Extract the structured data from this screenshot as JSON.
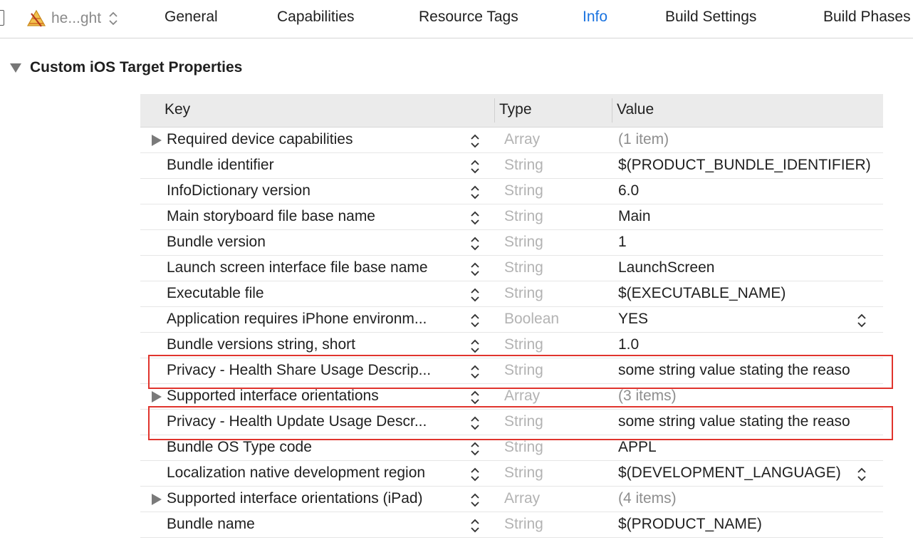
{
  "topbar": {
    "target_name": "he...ght",
    "tabs": [
      {
        "label": "General",
        "active": false
      },
      {
        "label": "Capabilities",
        "active": false
      },
      {
        "label": "Resource Tags",
        "active": false
      },
      {
        "label": "Info",
        "active": true
      },
      {
        "label": "Build Settings",
        "active": false
      },
      {
        "label": "Build Phases",
        "active": false
      }
    ],
    "active_color": "#1a73e0"
  },
  "section": {
    "title": "Custom iOS Target Properties",
    "expanded": true
  },
  "table": {
    "headers": {
      "key": "Key",
      "type": "Type",
      "value": "Value"
    },
    "rows": [
      {
        "key": "Required device capabilities",
        "type": "Array",
        "value": "(1 item)",
        "expandable": true,
        "value_muted": true,
        "value_popup": false,
        "highlighted": false
      },
      {
        "key": "Bundle identifier",
        "type": "String",
        "value": "$(PRODUCT_BUNDLE_IDENTIFIER)",
        "expandable": false,
        "value_muted": false,
        "value_popup": false,
        "highlighted": false
      },
      {
        "key": "InfoDictionary version",
        "type": "String",
        "value": "6.0",
        "expandable": false,
        "value_muted": false,
        "value_popup": false,
        "highlighted": false
      },
      {
        "key": "Main storyboard file base name",
        "type": "String",
        "value": "Main",
        "expandable": false,
        "value_muted": false,
        "value_popup": false,
        "highlighted": false
      },
      {
        "key": "Bundle version",
        "type": "String",
        "value": "1",
        "expandable": false,
        "value_muted": false,
        "value_popup": false,
        "highlighted": false
      },
      {
        "key": "Launch screen interface file base name",
        "type": "String",
        "value": "LaunchScreen",
        "expandable": false,
        "value_muted": false,
        "value_popup": false,
        "highlighted": false
      },
      {
        "key": "Executable file",
        "type": "String",
        "value": "$(EXECUTABLE_NAME)",
        "expandable": false,
        "value_muted": false,
        "value_popup": false,
        "highlighted": false
      },
      {
        "key": "Application requires iPhone environm...",
        "type": "Boolean",
        "value": "YES",
        "expandable": false,
        "value_muted": false,
        "value_popup": true,
        "highlighted": false
      },
      {
        "key": "Bundle versions string, short",
        "type": "String",
        "value": "1.0",
        "expandable": false,
        "value_muted": false,
        "value_popup": false,
        "highlighted": false
      },
      {
        "key": "Privacy - Health Share Usage Descrip...",
        "type": "String",
        "value": "some string value stating the reaso",
        "expandable": false,
        "value_muted": false,
        "value_popup": false,
        "highlighted": true
      },
      {
        "key": "Supported interface orientations",
        "type": "Array",
        "value": "(3 items)",
        "expandable": true,
        "value_muted": true,
        "value_popup": false,
        "highlighted": false
      },
      {
        "key": "Privacy - Health Update Usage Descr...",
        "type": "String",
        "value": "some string value stating the reaso",
        "expandable": false,
        "value_muted": false,
        "value_popup": false,
        "highlighted": true
      },
      {
        "key": "Bundle OS Type code",
        "type": "String",
        "value": "APPL",
        "expandable": false,
        "value_muted": false,
        "value_popup": false,
        "highlighted": false
      },
      {
        "key": "Localization native development region",
        "type": "String",
        "value": "$(DEVELOPMENT_LANGUAGE)",
        "expandable": false,
        "value_muted": false,
        "value_popup": true,
        "highlighted": false
      },
      {
        "key": "Supported interface orientations (iPad)",
        "type": "Array",
        "value": "(4 items)",
        "expandable": true,
        "value_muted": true,
        "value_popup": false,
        "highlighted": false
      },
      {
        "key": "Bundle name",
        "type": "String",
        "value": "$(PRODUCT_NAME)",
        "expandable": false,
        "value_muted": false,
        "value_popup": false,
        "highlighted": false
      }
    ],
    "highlight_color": "#e0342d"
  }
}
